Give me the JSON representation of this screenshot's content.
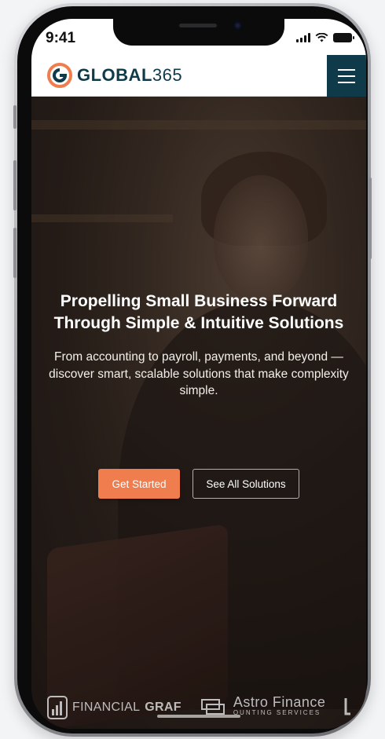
{
  "status_bar": {
    "time": "9:41"
  },
  "brand": {
    "name": "GLOBAL",
    "suffix": "365",
    "accent": "#ef7d4e",
    "navy": "#0f3a4a"
  },
  "hero": {
    "title": "Propelling Small Business Forward Through Simple & Intuitive Solutions",
    "subtitle": "From accounting to payroll, payments, and beyond —discover smart, scalable solutions that make complexity simple.",
    "primary_cta": "Get Started",
    "secondary_cta": "See All Solutions"
  },
  "partners": {
    "p1_light": "FINANCIAL",
    "p1_bold": "GRAF",
    "p2_name": "Astro Finance",
    "p2_sub": "OUNTING SERVICES"
  },
  "icons": {
    "menu": "hamburger-icon",
    "signal": "signal-icon",
    "wifi": "wifi-icon",
    "battery": "battery-icon"
  }
}
